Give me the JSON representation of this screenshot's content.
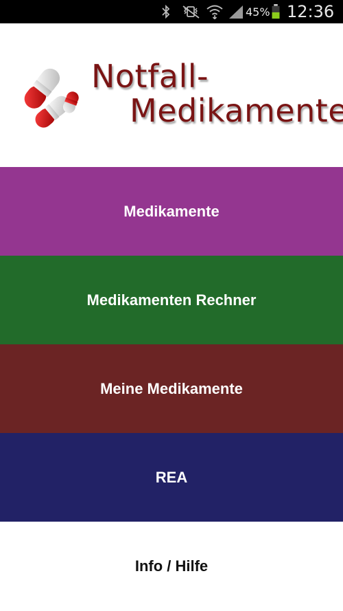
{
  "status_bar": {
    "icons": [
      "bluetooth-icon",
      "mute-vibrate-icon",
      "wifi-icon",
      "signal-icon",
      "battery-icon"
    ],
    "battery_percent": "45%",
    "time": "12:36"
  },
  "header": {
    "logo_line1": "Notfall-",
    "logo_line2": "Medikamente"
  },
  "menu": {
    "items": [
      {
        "label": "Medikamente",
        "color": "#943690"
      },
      {
        "label": "Medikamenten Rechner",
        "color": "#226b2a"
      },
      {
        "label": "Meine Medikamente",
        "color": "#6b2424"
      },
      {
        "label": "REA",
        "color": "#222266"
      }
    ],
    "info_label": "Info / Hilfe"
  }
}
